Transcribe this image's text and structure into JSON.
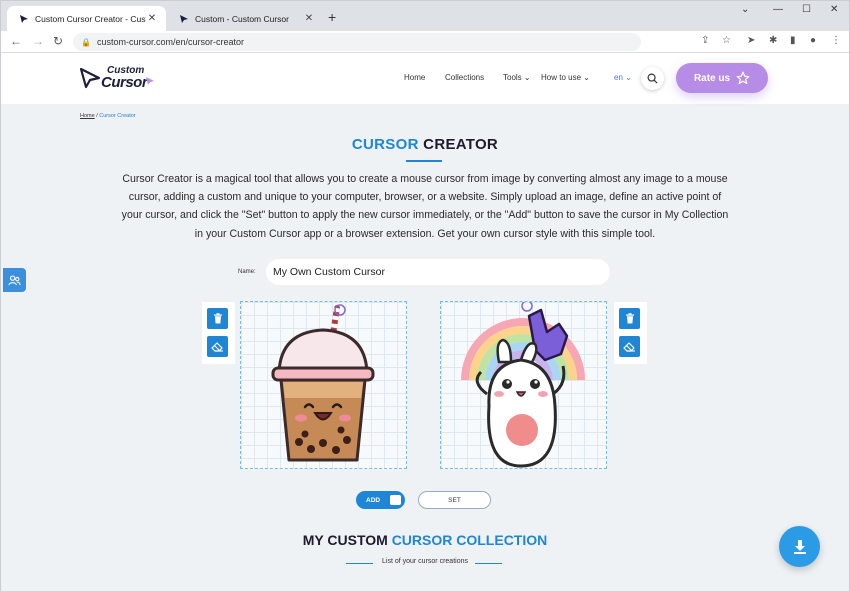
{
  "browser": {
    "tabs": [
      {
        "title": "Custom Cursor Creator - Custom",
        "active": true
      },
      {
        "title": "Custom - Custom Cursor",
        "active": false
      }
    ],
    "new_tab": "+",
    "url": "custom-cursor.com/en/cursor-creator"
  },
  "site": {
    "logo_line1": "Custom",
    "logo_line2": "Cursor",
    "nav": [
      "Home",
      "Collections",
      "Tools",
      "How to use"
    ],
    "lang": "en",
    "rate_label": "Rate us"
  },
  "breadcrumb": {
    "home": "Home",
    "sep": " / ",
    "current": "Cursor Creator"
  },
  "heading": {
    "part1": "CURSOR",
    "part2": " CREATOR"
  },
  "intro": "Cursor Creator is a magical tool that allows you to create a mouse cursor from image by converting almost any image to a mouse cursor, adding a custom and unique to your computer, browser, or a website. Simply upload an image, define an active point of your cursor, and click the \"Set\" button to apply the new cursor immediately, or the \"Add\" button to save the cursor in My Collection in your Custom Cursor app or a browser extension. Get your own cursor style with this simple tool.",
  "form": {
    "name_label": "Name:",
    "name_value": "My Own Custom Cursor"
  },
  "buttons": {
    "add": "ADD",
    "set": "SET"
  },
  "collection": {
    "part1": "MY CUSTOM ",
    "part2": "CURSOR COLLECTION",
    "subtitle": "List of your cursor creations"
  },
  "colors": {
    "accent": "#1f86d6",
    "rate": "#b68ce6",
    "page_bg": "#eef2f5"
  }
}
